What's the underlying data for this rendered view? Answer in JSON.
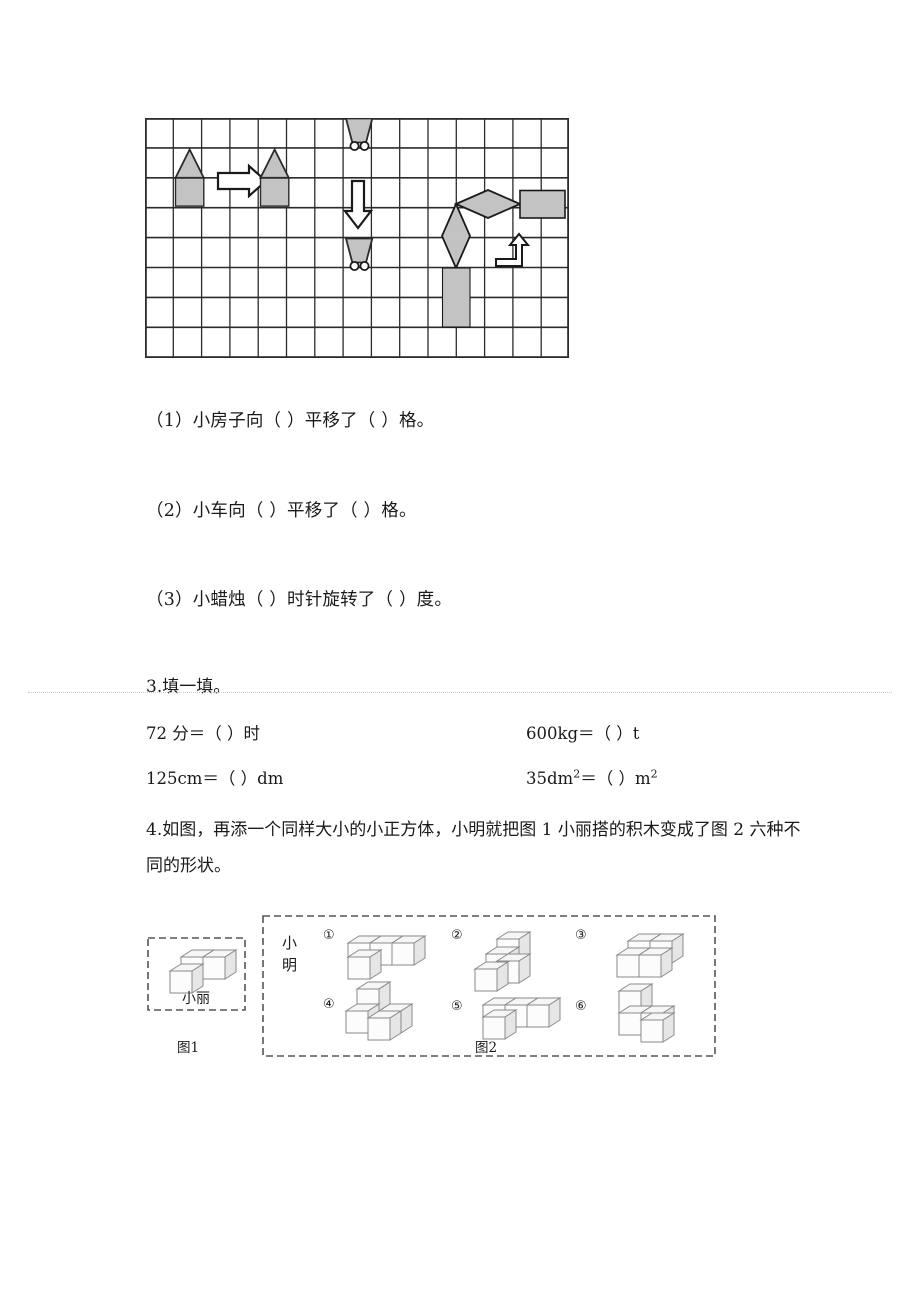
{
  "document": {
    "type": "math-worksheet",
    "language": "zh-CN"
  },
  "figure1": {
    "name": "translation-rotation-grid",
    "grid": {
      "columns": 15,
      "rows": 8,
      "cell": 28.3
    },
    "shapes": [
      {
        "id": "house-start",
        "type": "house",
        "label": "小房子起始位置"
      },
      {
        "id": "house-arrow",
        "type": "arrow-right",
        "label": "向右平移箭头"
      },
      {
        "id": "house-end",
        "type": "house",
        "label": "小房子终止位置"
      },
      {
        "id": "car-top",
        "type": "car",
        "label": "小车起始位置"
      },
      {
        "id": "car-arrow",
        "type": "arrow-down",
        "label": "向下平移箭头"
      },
      {
        "id": "car-bottom",
        "type": "car",
        "label": "小车终止位置"
      },
      {
        "id": "candle-vert",
        "type": "candle",
        "label": "小蜡烛起始位置"
      },
      {
        "id": "candle-horiz",
        "type": "candle",
        "label": "小蜡烛旋转后位置"
      },
      {
        "id": "rect-bar",
        "type": "rectangle",
        "label": "矩形"
      },
      {
        "id": "rot-arrow",
        "type": "arrow-elbow",
        "label": "旋转箭头"
      }
    ]
  },
  "questions": {
    "sub1": "（1）小房子向（        ）平移了（        ）格。",
    "sub2": "（2）小车向（        ）平移了（        ）格。",
    "sub3": "（3）小蜡烛（        ）时针旋转了（        ）度。",
    "q3_heading": "3.填一填。",
    "q4_heading": "4.如图，再添一个同样大小的小正方体，小明就把图 1 小丽搭的积木变成了图 2 六种不同的形状。"
  },
  "conversions": [
    {
      "left": "72 分＝（        ）时",
      "right": "600kg＝（        ）t"
    },
    {
      "left": "125cm＝（        ）dm",
      "right_pre": "35dm",
      "right_sup": "2",
      "right_post": "＝（        ）m",
      "right_post_sup": "2"
    }
  ],
  "conversion_lines": {
    "r1c1": "72 分＝（        ）时",
    "r1c2": "600kg＝（        ）t",
    "r2c1": "125cm＝（        ）dm",
    "r2c2_pre": "35dm",
    "r2c2_mid": "＝（        ）m"
  },
  "figure2": {
    "box1": {
      "name": "小丽",
      "caption": "图1",
      "cubes": 3
    },
    "box2": {
      "name_chars": [
        "小",
        "明"
      ],
      "caption": "图2",
      "items": [
        {
          "number": "①",
          "cubes": 4
        },
        {
          "number": "②",
          "cubes": 4
        },
        {
          "number": "③",
          "cubes": 4
        },
        {
          "number": "④",
          "cubes": 4
        },
        {
          "number": "⑤",
          "cubes": 4
        },
        {
          "number": "⑥",
          "cubes": 4
        }
      ]
    }
  },
  "colors": {
    "ink": "#1a1a1a",
    "grid_line": "#2b2b2b",
    "shape_fill": "#c3c3c3",
    "cube_face_light": "#fbfbfb",
    "cube_face_mid": "#eeeeee",
    "cube_face_dark": "#dcdcdc",
    "cube_stroke": "#8a8a8a",
    "dashed_border": "#555555",
    "dot_rule": "#c9c9c9"
  }
}
